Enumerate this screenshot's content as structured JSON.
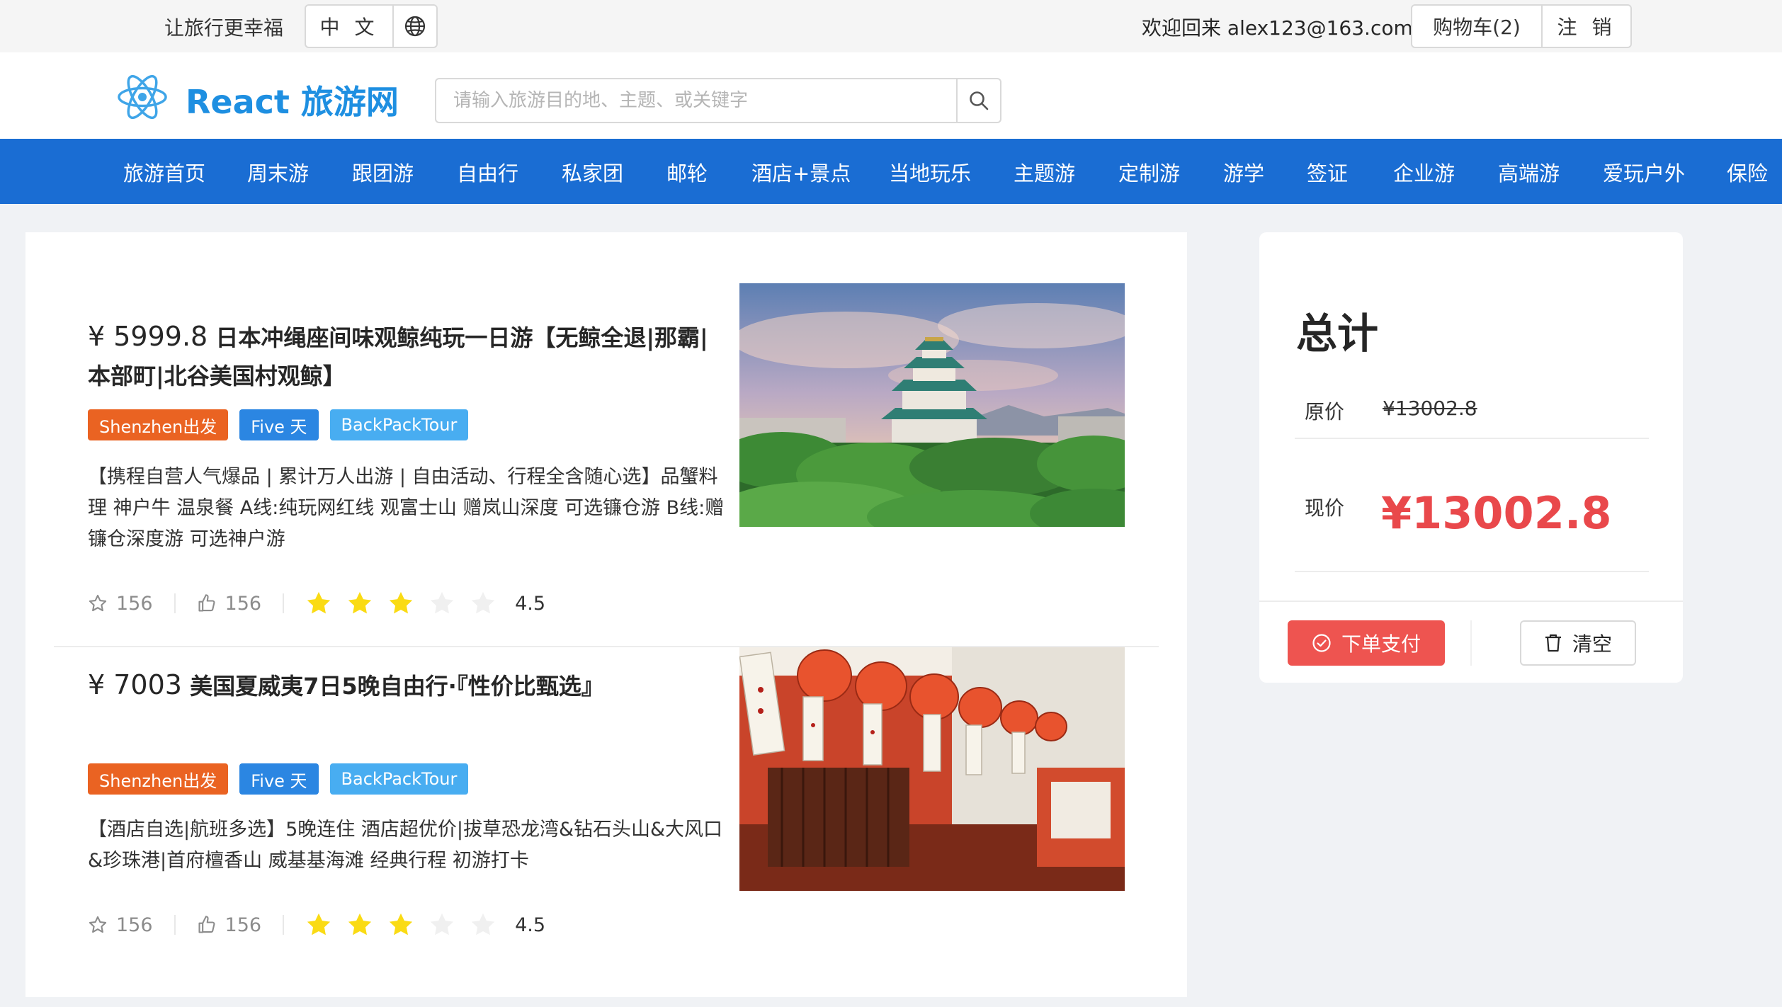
{
  "topbar": {
    "slogan": "让旅行更幸福",
    "language": "中 文",
    "welcome_prefix": "欢迎回来",
    "user_email": "alex123@163.com",
    "cart_label": "购物车(2)",
    "logout_label": "注 销"
  },
  "header": {
    "logo_text": "React 旅游网",
    "search_placeholder": "请输入旅游目的地、主题、或关键字"
  },
  "nav": {
    "items": [
      "旅游首页",
      "周末游",
      "跟团游",
      "自由行",
      "私家团",
      "邮轮",
      "酒店+景点",
      "当地玩乐",
      "主题游",
      "定制游",
      "游学",
      "签证",
      "企业游",
      "高端游",
      "爱玩户外",
      "保险"
    ]
  },
  "products": [
    {
      "price": "¥ 5999.8",
      "title": "日本冲绳座间味观鲸纯玩一日游【无鲸全退|那霸|本部町|北谷美国村观鲸】",
      "tags": [
        "Shenzhen出发",
        "Five 天",
        "BackPackTour"
      ],
      "description": "【携程自营人气爆品 | 累计万人出游 | 自由活动、行程全含随心选】品蟹料理 神户牛 温泉餐 A线:纯玩网红线 观富士山 赠岚山深度 可选镰仓游 B线:赠镰仓深度游 可选神户游",
      "favorites": "156",
      "likes": "156",
      "rating": "4.5",
      "filled_stars": 3,
      "total_stars": 5
    },
    {
      "price": "¥ 7003",
      "title": "美国夏威夷7日5晚自由行·『性价比甄选』",
      "tags": [
        "Shenzhen出发",
        "Five 天",
        "BackPackTour"
      ],
      "description": "【酒店自选|航班多选】5晚连住 酒店超优价|拔草恐龙湾&钻石头山&大风口&珍珠港|首府檀香山 威基基海滩 经典行程 初游打卡",
      "favorites": "156",
      "likes": "156",
      "rating": "4.5",
      "filled_stars": 3,
      "total_stars": 5
    }
  ],
  "summary": {
    "title": "总计",
    "original_label": "原价",
    "original_price": "¥13002.8",
    "current_label": "现价",
    "current_price": "¥13002.8",
    "pay_label": "下单支付",
    "clear_label": "清空"
  },
  "colors": {
    "nav_bg": "#1a6dd3",
    "logo_blue": "#1e8fe1",
    "price_red": "#e9484b",
    "tag_orange": "#ea6322",
    "tag_blue": "#2b86e2",
    "tag_sky": "#48adf1",
    "star_gold": "#fadb14"
  }
}
